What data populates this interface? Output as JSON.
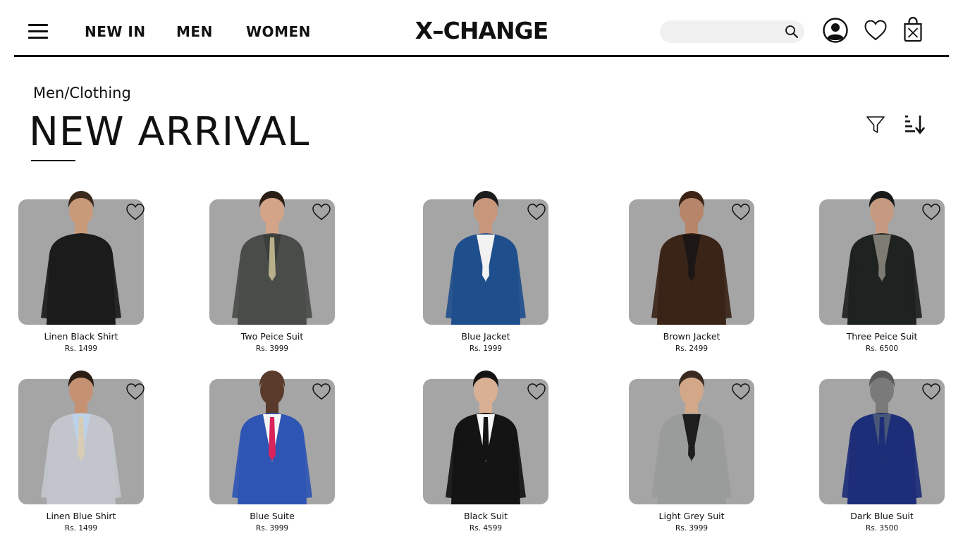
{
  "header": {
    "nav": [
      "NEW IN",
      "MEN",
      "WOMEN"
    ],
    "logo": "X–CHANGE",
    "search": {
      "placeholder": "",
      "value": ""
    },
    "icons": [
      "menu-icon",
      "search-icon",
      "user-icon",
      "heart-icon",
      "shopping-bag-icon"
    ]
  },
  "page": {
    "breadcrumb": "Men/Clothing",
    "title": "NEW ARRIVAL",
    "tools": [
      "filter-icon",
      "sort-icon"
    ]
  },
  "products": [
    {
      "name": "Linen Black Shirt",
      "price": "Rs. 1499",
      "jacket": "#1b1b1b",
      "shirt": "#1b1b1b",
      "accent": "#1b1b1b",
      "skin": "#c99a7a",
      "hair": "#3a2a1e"
    },
    {
      "name": "Two Peice Suit",
      "price": "Rs. 3999",
      "jacket": "#4a4c4a",
      "shirt": "#3c3e3c",
      "accent": "#b8b08a",
      "skin": "#d4a488",
      "hair": "#2a1e16"
    },
    {
      "name": "Blue Jacket",
      "price": "Rs. 1999",
      "jacket": "#1f4e8c",
      "shirt": "#f2f2f2",
      "accent": "#f2f2f2",
      "skin": "#c8967a",
      "hair": "#1c1c1c"
    },
    {
      "name": "Brown Jacket",
      "price": "Rs. 2499",
      "jacket": "#3a2418",
      "shirt": "#1c1614",
      "accent": "#1c1614",
      "skin": "#b7866a",
      "hair": "#3b2416"
    },
    {
      "name": "Three Peice Suit",
      "price": "Rs. 6500",
      "jacket": "#1e2220",
      "shirt": "#7d7b72",
      "accent": "#7d7b72",
      "skin": "#c59a80",
      "hair": "#1a1a1a"
    },
    {
      "name": "Linen Blue Shirt",
      "price": "Rs. 1499",
      "jacket": "#c2c6cc",
      "shirt": "#bcd2ea",
      "accent": "#d8ccb4",
      "skin": "#c49272",
      "hair": "#2c1e14"
    },
    {
      "name": "Blue Suite",
      "price": "Rs. 3999",
      "jacket": "#2f55b4",
      "shirt": "#f5f5f5",
      "accent": "#d8245a",
      "skin": "#5a3a2a",
      "hair": "#5a3a2a"
    },
    {
      "name": "Black Suit",
      "price": "Rs. 4599",
      "jacket": "#141414",
      "shirt": "#f5f5f5",
      "accent": "#141414",
      "skin": "#d9b094",
      "hair": "#141414"
    },
    {
      "name": "Light Grey Suit",
      "price": "Rs. 3999",
      "jacket": "#9a9c9c",
      "shirt": "#1e1e1e",
      "accent": "#1e1e1e",
      "skin": "#d3a888",
      "hair": "#3a2a20"
    },
    {
      "name": "Dark Blue Suit",
      "price": "Rs. 3500",
      "jacket": "#1d2e78",
      "shirt": "#4a5878",
      "accent": "#1d2e78",
      "skin": "#7a7a7a",
      "hair": "#5a5a5a"
    }
  ]
}
